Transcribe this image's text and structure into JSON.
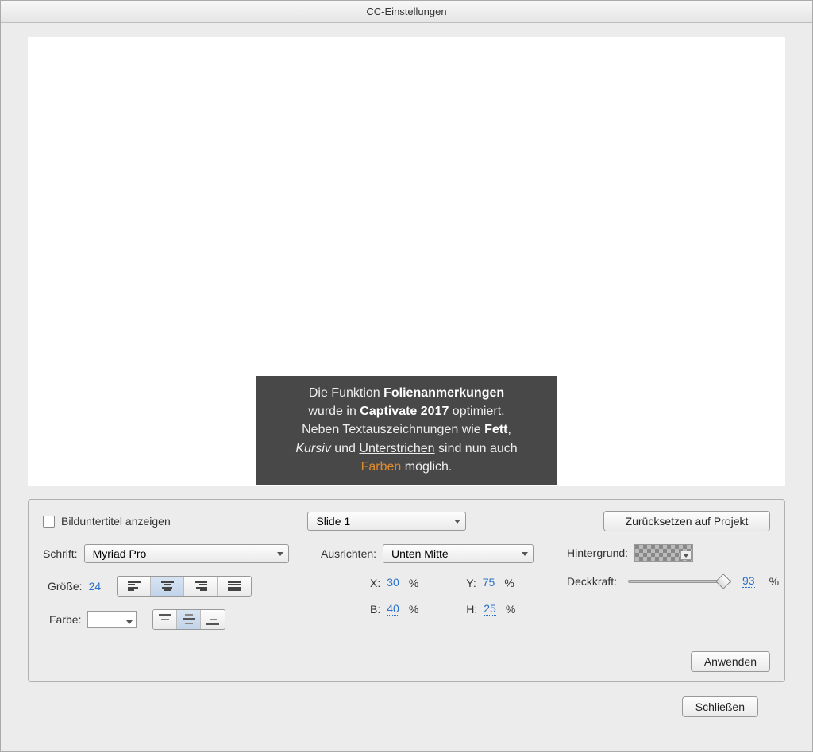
{
  "title": "CC-Einstellungen",
  "caption_html": "Die Funktion <b>Folienanmerkungen</b><br>wurde in <b>Captivate 2017</b> optimiert.<br>Neben Textauszeichnungen wie <b>Fett</b>,<br><i>Kursiv</i> und <u>Unterstrichen</u> sind nun auch<br><span class=\"orange\">Farben</span> möglich.",
  "panel": {
    "show_caption_label": "Bilduntertitel anzeigen",
    "slide_dropdown": "Slide 1",
    "reset_button": "Zurücksetzen auf Projekt",
    "font_label": "Schrift:",
    "font_value": "Myriad Pro",
    "size_label": "Größe:",
    "size_value": "24",
    "color_label": "Farbe:",
    "align_label": "Ausrichten:",
    "align_value": "Unten Mitte",
    "x_label": "X:",
    "x_value": "30",
    "y_label": "Y:",
    "y_value": "75",
    "b_label": "B:",
    "b_value": "40",
    "h_label": "H:",
    "h_value": "25",
    "bg_label": "Hintergrund:",
    "opacity_label": "Deckkraft:",
    "opacity_value": "93",
    "opacity_percent": 93,
    "apply_button": "Anwenden"
  },
  "close_button": "Schließen"
}
